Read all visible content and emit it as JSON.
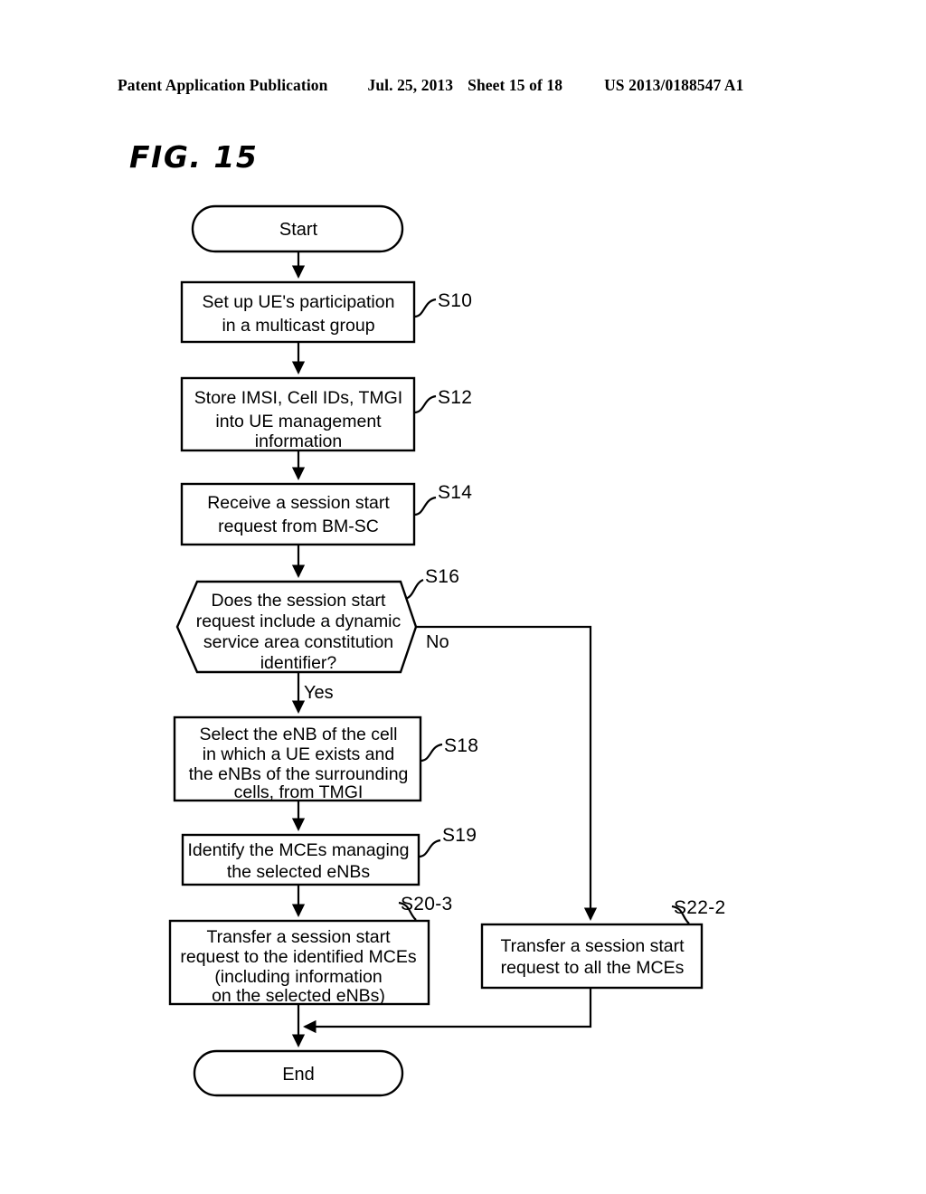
{
  "header": {
    "publication": "Patent Application Publication",
    "date": "Jul. 25, 2013",
    "sheet": "Sheet 15 of 18",
    "number": "US 2013/0188547 A1"
  },
  "figure": {
    "label": "FIG. 15"
  },
  "flowchart": {
    "start": {
      "label": "Start"
    },
    "end": {
      "label": "End"
    },
    "branch_yes": "Yes",
    "branch_no": "No",
    "nodes": [
      {
        "id": "S10",
        "shape": "process",
        "lines": [
          "Set up UE's participation",
          "in a multicast group"
        ]
      },
      {
        "id": "S12",
        "shape": "process",
        "lines": [
          "Store IMSI, Cell IDs, TMGI",
          "into UE management",
          "information"
        ]
      },
      {
        "id": "S14",
        "shape": "process",
        "lines": [
          "Receive a session start",
          "request from BM-SC"
        ]
      },
      {
        "id": "S16",
        "shape": "decision",
        "lines": [
          "Does the session start",
          "request include a dynamic",
          "service  area constitution",
          "identifier?"
        ]
      },
      {
        "id": "S18",
        "shape": "process",
        "lines": [
          "Select the eNB of the cell",
          "in which a UE exists and",
          "the eNBs of the surrounding",
          "cells, from TMGI"
        ]
      },
      {
        "id": "S19",
        "shape": "process",
        "lines": [
          "Identify the MCEs managing",
          "the selected eNBs"
        ]
      },
      {
        "id": "S20-3",
        "shape": "process",
        "lines": [
          "Transfer a session start",
          "request to the identified MCEs",
          "(including information",
          "on the selected eNBs)"
        ]
      },
      {
        "id": "S22-2",
        "shape": "process",
        "lines": [
          "Transfer a session start",
          "request to all the MCEs"
        ]
      }
    ]
  },
  "colors": {
    "ink": "#000000",
    "paper": "#ffffff"
  }
}
